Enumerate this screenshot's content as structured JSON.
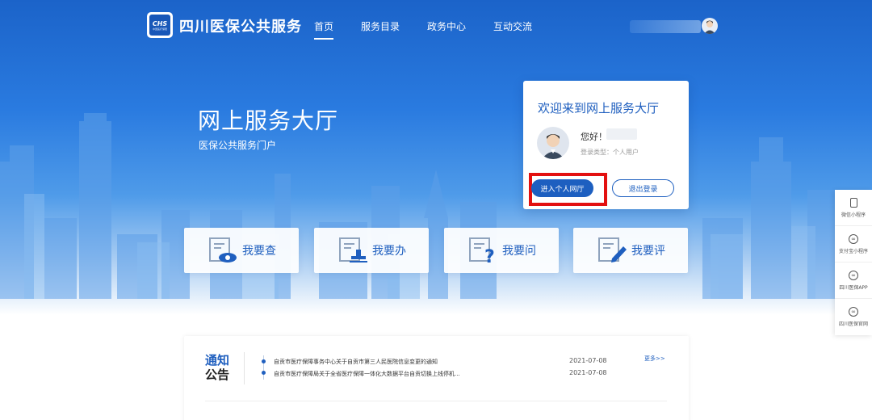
{
  "header": {
    "logo_text": "CHS",
    "logo_subtext": "中国医疗保障",
    "site_title": "四川医保公共服务",
    "nav": [
      {
        "label": "首页",
        "active": true
      },
      {
        "label": "服务目录",
        "active": false
      },
      {
        "label": "政务中心",
        "active": false
      },
      {
        "label": "互动交流",
        "active": false
      }
    ]
  },
  "hero": {
    "title": "网上服务大厅",
    "subtitle": "医保公共服务门户"
  },
  "login_card": {
    "title": "欢迎来到网上服务大厅",
    "greeting": "您好！",
    "user_type": "登录类型：个人用户",
    "enter_button": "进入个人网厅",
    "logout_button": "退出登录"
  },
  "services": [
    {
      "label": "我要查",
      "icon": "magnifier-eye-icon"
    },
    {
      "label": "我要办",
      "icon": "stamp-icon"
    },
    {
      "label": "我要问",
      "icon": "question-icon"
    },
    {
      "label": "我要评",
      "icon": "pen-icon"
    }
  ],
  "sidebar": [
    {
      "label": "微信小程序",
      "icon": "phone-icon"
    },
    {
      "label": "支付宝小程序",
      "icon": "link-icon"
    },
    {
      "label": "四川医保APP",
      "icon": "link-icon"
    },
    {
      "label": "四川医保官网",
      "icon": "link-icon"
    }
  ],
  "notice": {
    "title_line1": "通知",
    "title_line2": "公告",
    "more": "更多>>",
    "items": [
      {
        "text": "自贡市医疗保障事务中心关于自贡市第三人民医院信息变更的通知",
        "date": "2021-07-08"
      },
      {
        "text": "自贡市医疗保障局关于全省医疗保障一体化大数据平台自贡切换上线停机...",
        "date": "2021-07-08"
      }
    ]
  },
  "colors": {
    "primary": "#1f5fbf",
    "highlight": "#e31010"
  }
}
